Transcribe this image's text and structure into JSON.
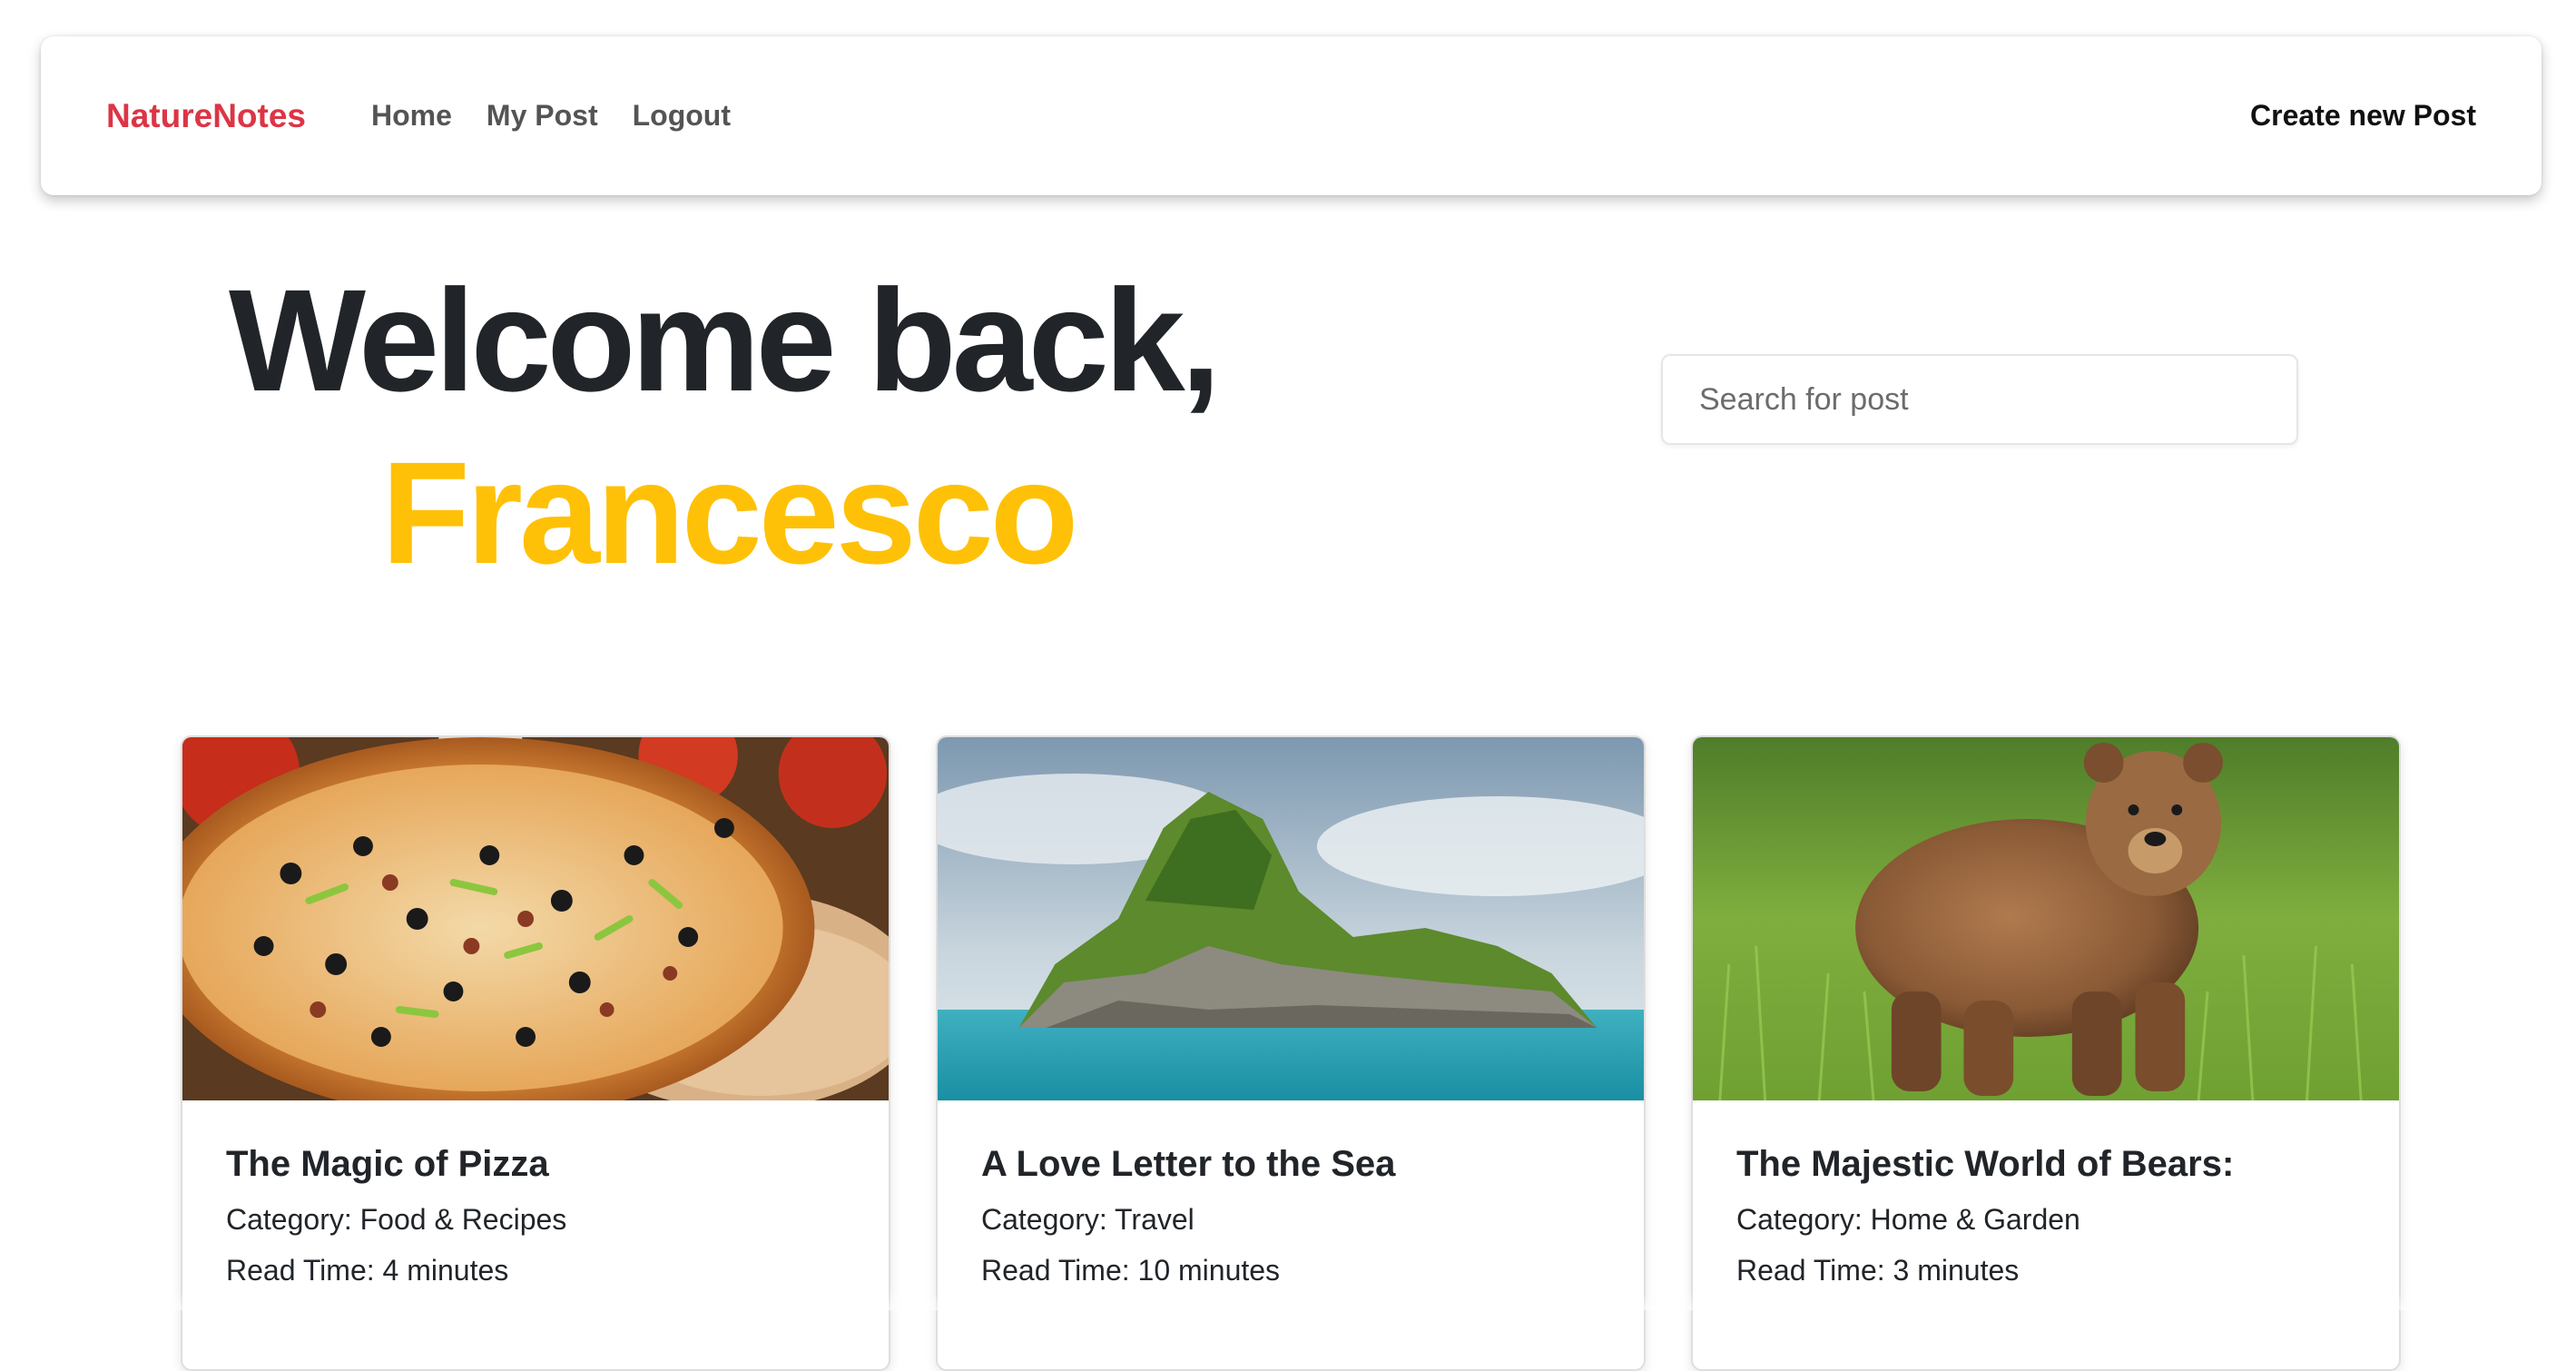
{
  "navbar": {
    "brand": "NatureNotes",
    "links": [
      {
        "label": "Home"
      },
      {
        "label": "My Post"
      },
      {
        "label": "Logout"
      }
    ],
    "create_post": "Create new Post"
  },
  "hero": {
    "greeting": "Welcome back,",
    "username": "Francesco"
  },
  "search": {
    "placeholder": "Search for post"
  },
  "posts": [
    {
      "image": "pizza-photo",
      "title": "The Magic of Pizza",
      "category": "Category: Food & Recipes",
      "read_time": "Read Time: 4 minutes"
    },
    {
      "image": "island-photo",
      "title": "A Love Letter to the Sea",
      "category": "Category: Travel",
      "read_time": "Read Time: 10 minutes"
    },
    {
      "image": "bear-photo",
      "title": "The Majestic World of Bears:",
      "category": "Category: Home & Garden",
      "read_time": "Read Time: 3 minutes"
    }
  ],
  "colors": {
    "brand": "#dc3545",
    "accent": "#ffc107",
    "text": "#212529"
  }
}
